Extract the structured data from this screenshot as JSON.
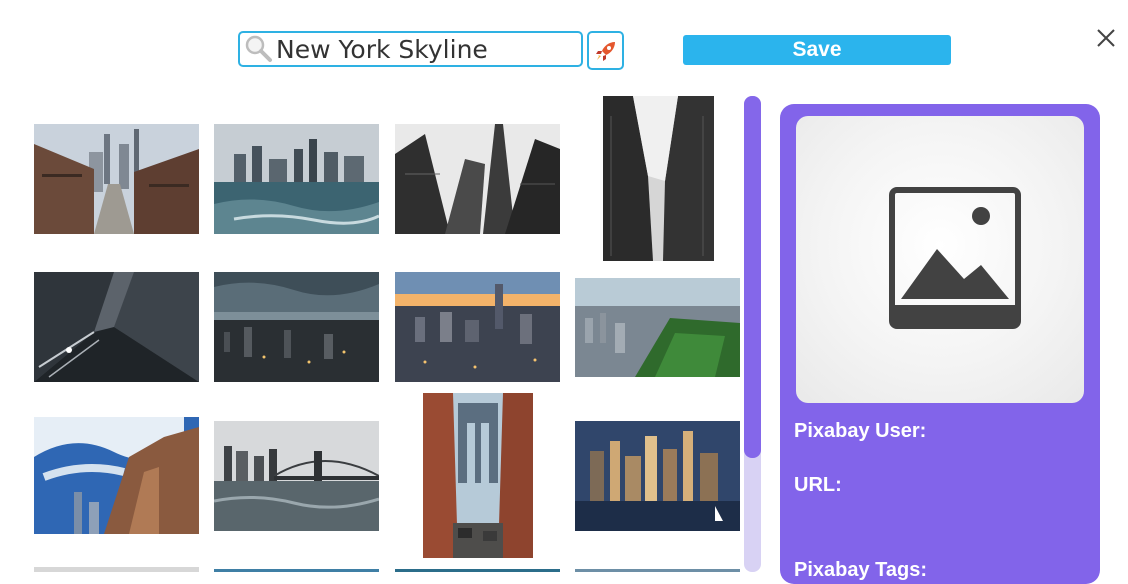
{
  "search": {
    "value": "New York Skyline",
    "icon": "search-icon"
  },
  "toolbar": {
    "rocket_icon": "rocket-icon",
    "save_label": "Save",
    "close_icon": "close-icon"
  },
  "details": {
    "user_label": "Pixabay User:",
    "url_label": "URL:",
    "tags_label": "Pixabay Tags:",
    "placeholder_icon": "image-placeholder-icon"
  },
  "colors": {
    "accent_blue": "#2bb4ed",
    "panel_purple": "#8264ea",
    "scrollbar_thumb": "#8467ea",
    "scrollbar_track": "#d8d2f4"
  },
  "results": [
    "result-street-view-manhattan",
    "result-manhattan-across-water",
    "result-bw-skyscrapers-looking-up",
    "result-vertical-looking-up-buildings",
    "result-dark-looking-up-towers",
    "result-stormy-aerial-city",
    "result-sunset-aerial-wtc",
    "result-central-park-aerial",
    "result-blue-sky-street-buildings",
    "result-brooklyn-bridge-skyline",
    "result-manhattan-bridge-dumbo",
    "result-dusk-skyline-sailboat"
  ]
}
